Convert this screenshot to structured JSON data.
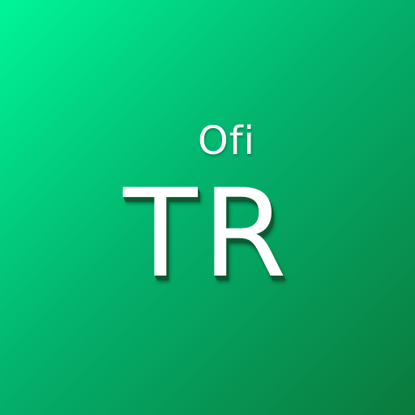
{
  "app_icon": {
    "subtitle": "Ofi",
    "title": "TR",
    "colors": {
      "gradient_start": "#00f598",
      "gradient_mid": "#03b06c",
      "gradient_end": "#0a7a3c",
      "text": "#ffffff",
      "shadow": "#0c5a33"
    }
  }
}
